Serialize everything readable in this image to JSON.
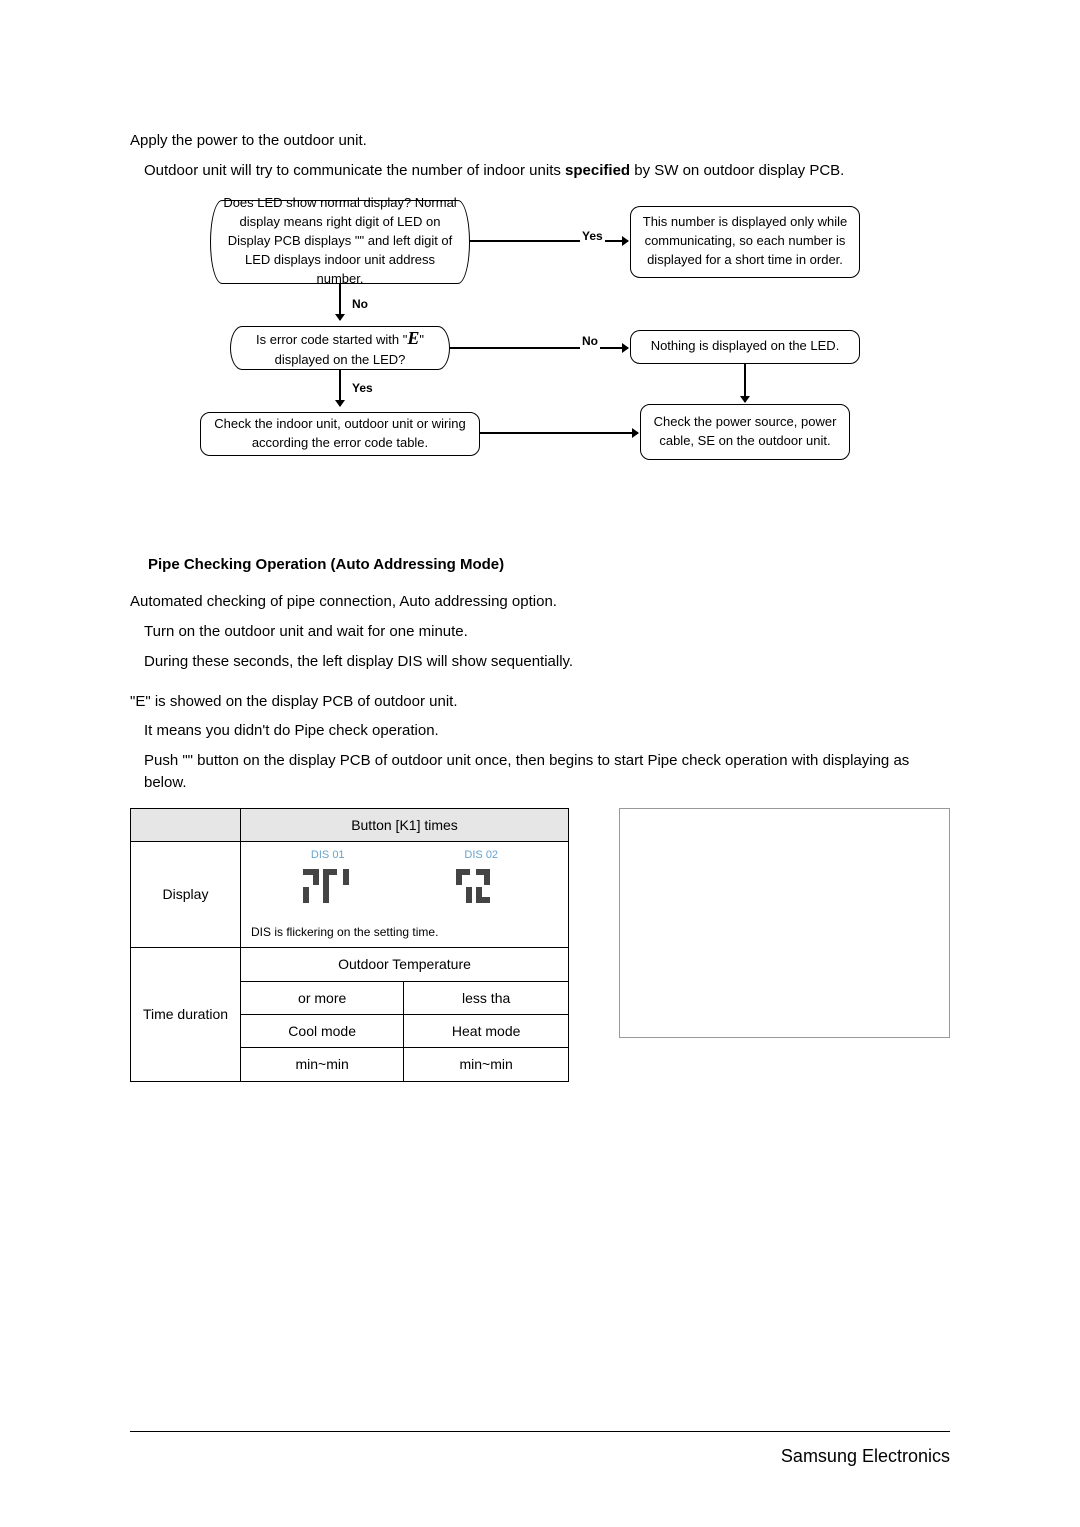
{
  "intro": {
    "line1": "Apply the power to the outdoor unit.",
    "line2_pre": "Outdoor unit will try to communicate the number of indoor units ",
    "line2_bold": "specified",
    "line2_post": " by SW on outdoor display PCB."
  },
  "flow": {
    "q1": "Does LED show normal display? Normal display means right digit of LED on Display PCB displays \"\" and left digit of LED displays indoor unit address number.",
    "note1": "This number is displayed only while communicating, so each number is displayed for a short time in order.",
    "q2_pre": "Is error code started with \"",
    "q2_sym": "E",
    "q2_post": "\" displayed on the LED?",
    "note2": "Nothing is displayed on the LED.",
    "act1": "Check the indoor unit, outdoor unit or wiring according the error code table.",
    "act2": "Check the power source, power cable, SE on the outdoor unit.",
    "yes": "Yes",
    "no_lbl": "No",
    "yes2": "Yes"
  },
  "section_title": "Pipe Checking Operation (Auto Addressing Mode)",
  "body": {
    "p1": "Automated checking of pipe connection, Auto addressing option.",
    "p1a": "Turn on the outdoor unit and wait for one minute.",
    "p1b": "During these seconds, the left display DIS will show sequentially.",
    "p2": "\"E\" is showed on the display PCB of outdoor unit.",
    "p2a": "It means you didn't do Pipe check operation.",
    "p3": "Push \"\" button on the display PCB of outdoor unit once, then begins to start Pipe check operation with displaying as below."
  },
  "table": {
    "hdr_button": "Button [K1] times",
    "row_display": "Display",
    "dis01": "DIS 01",
    "dis02": "DIS 02",
    "seg_left": "⎡⎤⎡",
    "seg_right": "⎡⎤⎤",
    "note": "DIS    is flickering on the setting time.",
    "row_time": "Time duration",
    "outdoor_temp": "Outdoor Temperature",
    "col_more": "or more",
    "col_less": "less tha",
    "cool": "Cool mode",
    "heat": "Heat mode",
    "min1": "min~min",
    "min2": "min~min"
  },
  "footer": "Samsung Electronics"
}
